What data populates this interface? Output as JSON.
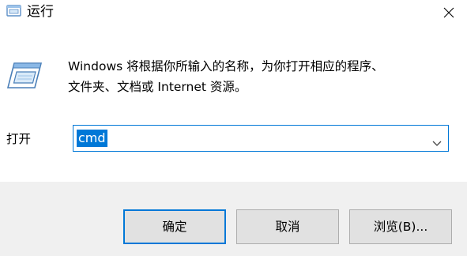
{
  "window": {
    "title": "运行",
    "close_icon": "close-icon",
    "app_icon": "run-icon"
  },
  "body": {
    "description_line1": "Windows 将根据你所输入的名称，为你打开相应的程序、",
    "description_line2": "文件夹、文档或 Internet 资源。",
    "open_label": "打开",
    "command_value": "cmd",
    "dropdown_icon": "chevron-down-icon"
  },
  "buttons": {
    "ok": "确定",
    "cancel": "取消",
    "browse": "浏览(B)..."
  },
  "colors": {
    "accent": "#0078d7",
    "button_face": "#e1e1e1",
    "bottom_bar": "#f0f0f0"
  }
}
